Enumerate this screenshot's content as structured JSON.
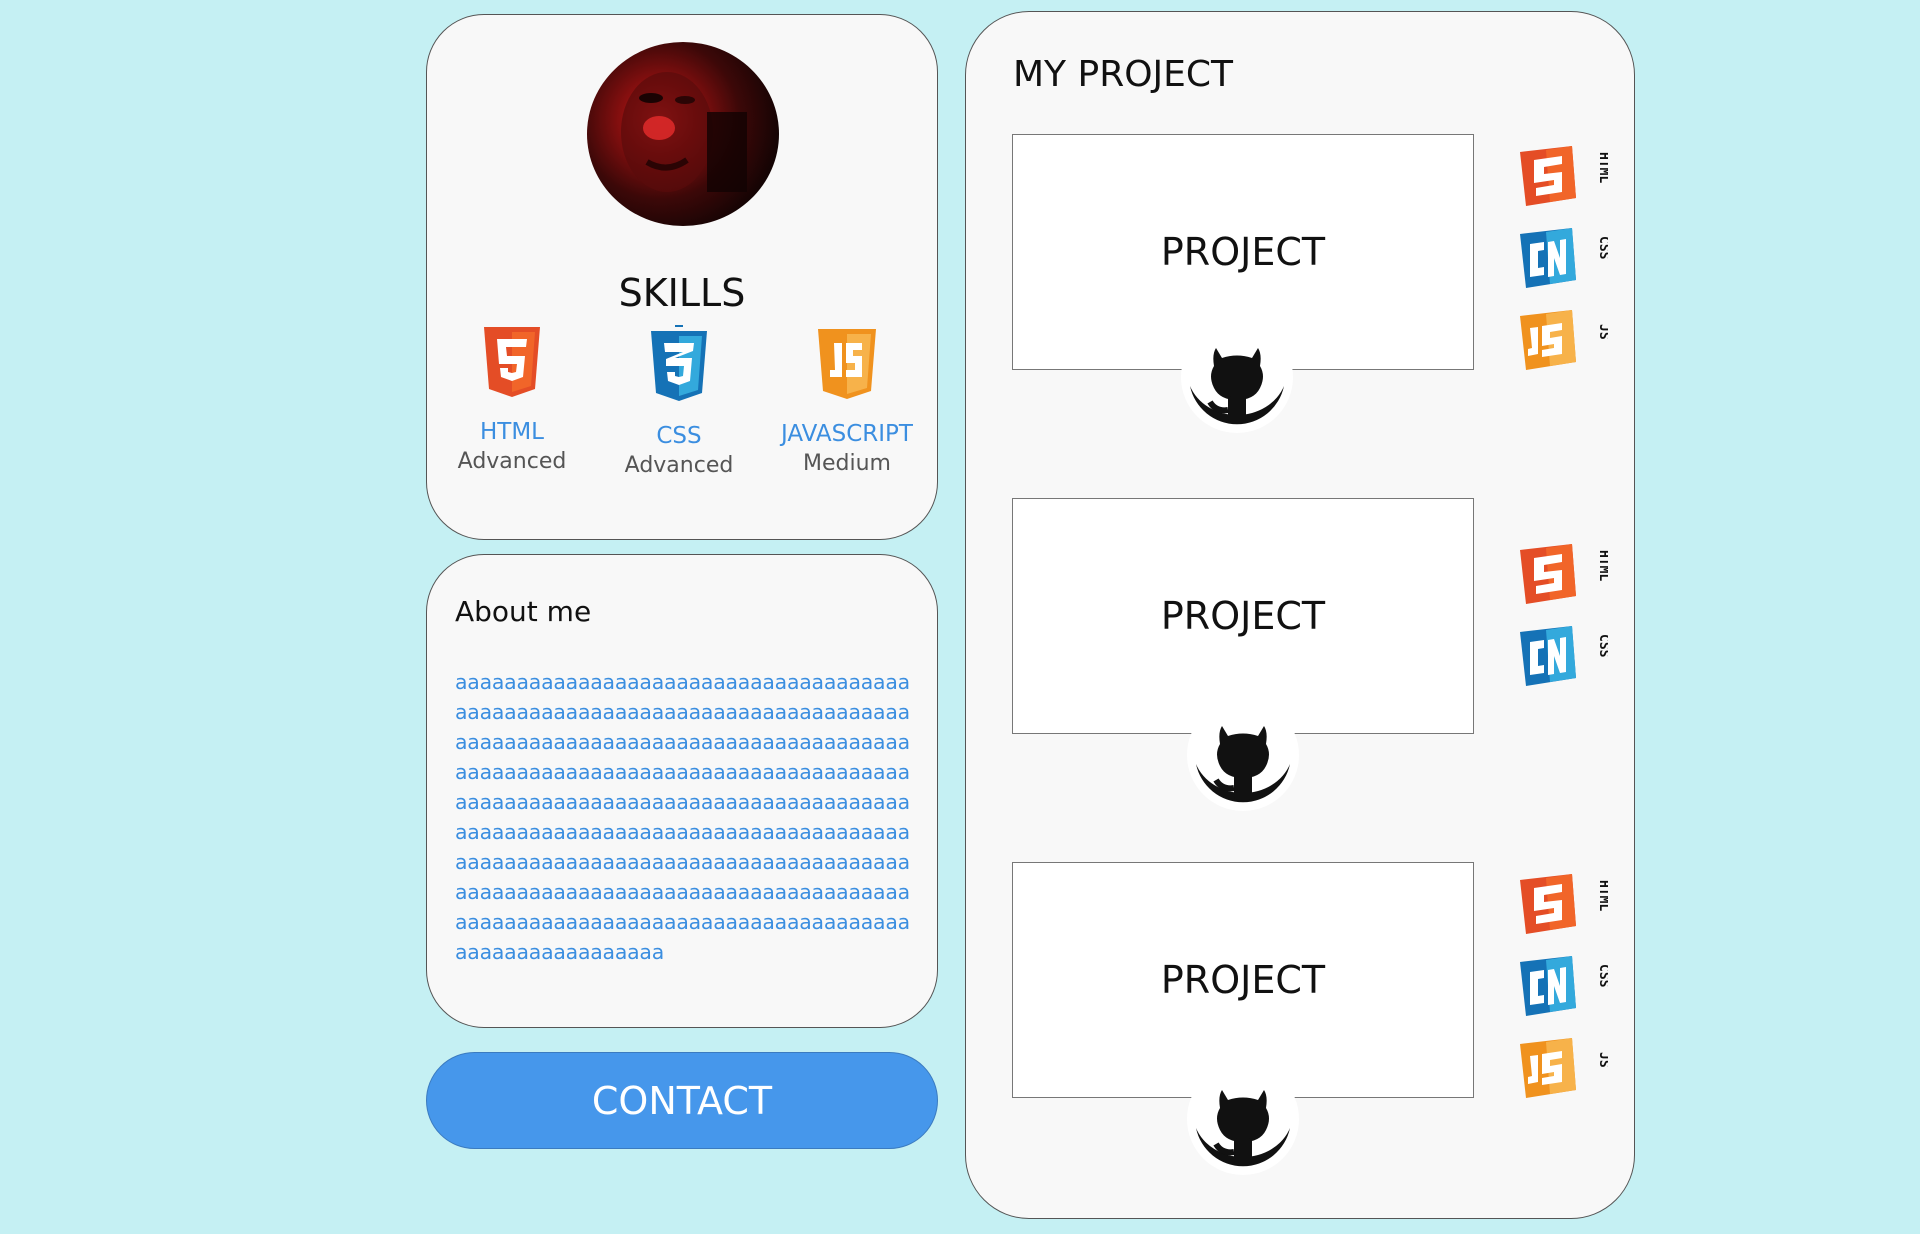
{
  "profile": {
    "skills_title": "SKILLS",
    "skills": [
      {
        "name": "HTML",
        "level": "Advanced",
        "icon": "html5-icon",
        "color": "#e44d26"
      },
      {
        "name": "CSS",
        "level": "Advanced",
        "icon": "css3-icon",
        "color": "#1572b6"
      },
      {
        "name": "JAVASCRIPT",
        "level": "Medium",
        "icon": "js-icon",
        "color": "#f0921e"
      }
    ]
  },
  "about": {
    "title": "About me",
    "text": "aaaaaaaaaaaaaaaaaaaaaaaaaaaaaaaaaaaaaaaaaaaaaaaaaaaaaaaaaaaaaaaaaaaaaaaaaaaaaaaaaaaaaaaaaaaaaaaaaaaaaaaaaaaaaaaaaaaaaaaaaaaaaaaaaaaaaaaaaaaaaaaaaaaaaaaaaaaaaaaaaaaaaaaaaaaaaaaaaaaaaaaaaaaaaaaaaaaaaaaaaaaaaaaaaaaaaaaaaaaaaaaaaaaaaaaaaaaaaaaaaaaaaaaaaaaaaaaaaaaaaaaaaaaaaaaaaaaaaaaaaaaaaaaaaaaaaaaaaaaaaaaaaaaaaaaaaaaaaaaaaaaaaaaaaaaaaaaaaaaaaaaaaaaaaa"
  },
  "contact": {
    "label": "CONTACT"
  },
  "projects": {
    "title": "MY PROJECT",
    "items": [
      {
        "label": "PROJECT",
        "tech": [
          "HTML",
          "CSS",
          "JS"
        ]
      },
      {
        "label": "PROJECT",
        "tech": [
          "HTML",
          "CSS"
        ]
      },
      {
        "label": "PROJECT",
        "tech": [
          "HTML",
          "CSS",
          "JS"
        ]
      }
    ]
  },
  "colors": {
    "background": "#c5f0f3",
    "card": "#f8f8f8",
    "accent": "#4697eb",
    "link_text": "#3b8ee0"
  }
}
